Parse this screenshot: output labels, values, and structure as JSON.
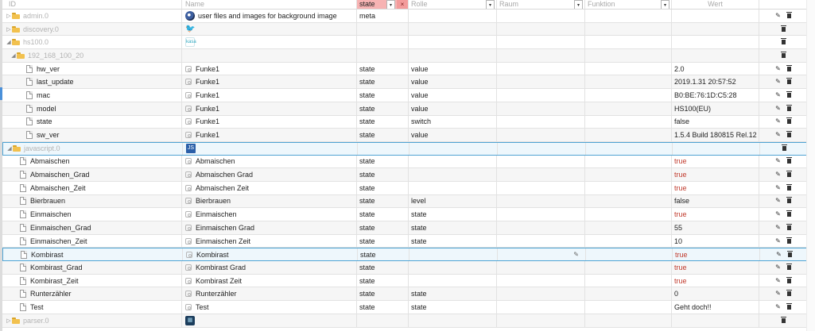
{
  "header": {
    "id": "ID",
    "name": "Name",
    "type_filter": "state",
    "type_clear": "×",
    "role": "Rolle",
    "room": "Raum",
    "function": "Funktion",
    "value": "Wert",
    "dropdown_glyph": "▾"
  },
  "icons": {
    "expand_closed": "▷",
    "expand_open": "◢",
    "edit": "✎",
    "bird": "🐦",
    "js": "JS",
    "kasa": "kasa",
    "parser": "▦"
  },
  "rows": [
    {
      "id": "admin.0",
      "name": "user files and images for background image",
      "type": "meta",
      "role": "",
      "value": ""
    },
    {
      "id": "discovery.0",
      "name": "",
      "type": "",
      "role": "",
      "value": ""
    },
    {
      "id": "hs100.0",
      "name": "",
      "type": "",
      "role": "",
      "value": ""
    },
    {
      "id": "192_168_100_20",
      "name": "",
      "type": "",
      "role": "",
      "value": ""
    },
    {
      "id": "hw_ver",
      "name": "Funke1",
      "type": "state",
      "role": "value",
      "value": "2.0"
    },
    {
      "id": "last_update",
      "name": "Funke1",
      "type": "state",
      "role": "value",
      "value": "2019.1.31 20:57:52"
    },
    {
      "id": "mac",
      "name": "Funke1",
      "type": "state",
      "role": "value",
      "value": "B0:BE:76:1D:C5:28"
    },
    {
      "id": "model",
      "name": "Funke1",
      "type": "state",
      "role": "value",
      "value": "HS100(EU)"
    },
    {
      "id": "state",
      "name": "Funke1",
      "type": "state",
      "role": "switch",
      "value": "false"
    },
    {
      "id": "sw_ver",
      "name": "Funke1",
      "type": "state",
      "role": "value",
      "value": "1.5.4 Build 180815 Rel.12"
    },
    {
      "id": "javascript.0",
      "name": "",
      "type": "",
      "role": "",
      "value": ""
    },
    {
      "id": "Abmaischen",
      "name": "Abmaischen",
      "type": "state",
      "role": "",
      "value": "true"
    },
    {
      "id": "Abmaischen_Grad",
      "name": "Abmaischen Grad",
      "type": "state",
      "role": "",
      "value": "true"
    },
    {
      "id": "Abmaischen_Zeit",
      "name": "Abmaischen Zeit",
      "type": "state",
      "role": "",
      "value": "true"
    },
    {
      "id": "Bierbrauen",
      "name": "Bierbrauen",
      "type": "state",
      "role": "level",
      "value": "false"
    },
    {
      "id": "Einmaischen",
      "name": "Einmaischen",
      "type": "state",
      "role": "state",
      "value": "true"
    },
    {
      "id": "Einmaischen_Grad",
      "name": "Einmaischen Grad",
      "type": "state",
      "role": "state",
      "value": "55"
    },
    {
      "id": "Einmaischen_Zeit",
      "name": "Einmaischen Zeit",
      "type": "state",
      "role": "state",
      "value": "10"
    },
    {
      "id": "Kombirast",
      "name": "Kombirast",
      "type": "state",
      "role": "",
      "value": "true"
    },
    {
      "id": "Kombirast_Grad",
      "name": "Kombirast Grad",
      "type": "state",
      "role": "",
      "value": "true"
    },
    {
      "id": "Kombirast_Zeit",
      "name": "Kombirast Zeit",
      "type": "state",
      "role": "",
      "value": "true"
    },
    {
      "id": "Runterzähler",
      "name": "Runterzähler",
      "type": "state",
      "role": "state",
      "value": "0"
    },
    {
      "id": "Test",
      "name": "Test",
      "type": "state",
      "role": "state",
      "value": "Geht doch!!"
    },
    {
      "id": "parser.0",
      "name": "",
      "type": "",
      "role": "",
      "value": ""
    }
  ],
  "colors": {
    "type_filter_bg": "#f7b3b3",
    "true_value": "#c0392b",
    "selected_border": "#4fa3d3",
    "folder": "#f2c14e"
  }
}
